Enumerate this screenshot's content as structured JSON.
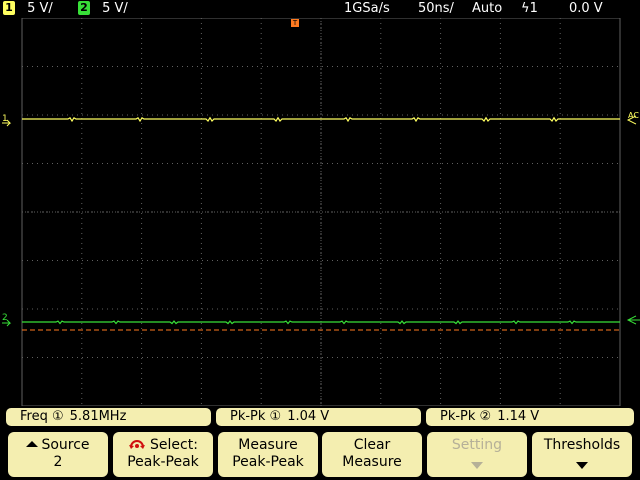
{
  "status": {
    "ch1_number": "1",
    "ch1_scale": "5 V/",
    "ch2_number": "2",
    "ch2_scale": "5 V/",
    "sample_rate": "1GSa/s",
    "timebase": "50ns/",
    "trigger_mode": "Auto",
    "trigger_source": "ϟ1",
    "trigger_level": "0.0 V",
    "trigger_marker": "T"
  },
  "markers": {
    "ch1_ground": "1",
    "ch2_ground": "2",
    "ac_label": "AC"
  },
  "measurements": [
    {
      "label": "Freq ①",
      "value": "5.81MHz"
    },
    {
      "label": "Pk-Pk ①",
      "value": "1.04  V"
    },
    {
      "label": "Pk-Pk ②",
      "value": "1.14  V"
    }
  ],
  "softkeys": [
    {
      "line1": "Source",
      "line2": "2",
      "icon": "up-arrow-icon",
      "enabled": true
    },
    {
      "line1": "Select:",
      "line2": "Peak-Peak",
      "icon": "rotate-knob-icon",
      "enabled": true
    },
    {
      "line1": "Measure",
      "line2": "Peak-Peak",
      "enabled": true
    },
    {
      "line1": "Clear",
      "line2": "Measure",
      "enabled": true
    },
    {
      "line1": "Setting",
      "line2": "",
      "icon": "down-arrow-icon",
      "enabled": false
    },
    {
      "line1": "Thresholds",
      "line2": "",
      "icon": "down-arrow-icon",
      "enabled": true
    }
  ],
  "colors": {
    "ch1": "#ffff60",
    "ch2": "#38e038",
    "trigger": "#ff7a20",
    "grid": "#606060",
    "panel": "#f4eeb0"
  }
}
